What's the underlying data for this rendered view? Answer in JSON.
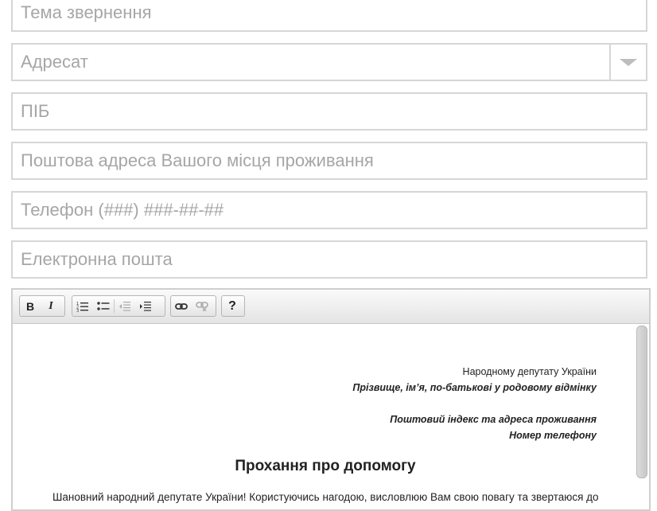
{
  "form": {
    "subject_placeholder": "Тема звернення",
    "addressee_placeholder": "Адресат",
    "name_placeholder": "ПІБ",
    "address_placeholder": "Поштова адреса Вашого місця проживання",
    "phone_placeholder": "Телефон (###) ###-##-##",
    "email_placeholder": "Електронна пошта"
  },
  "toolbar": {
    "bold": "B",
    "italic": "I",
    "help": "?"
  },
  "editor": {
    "line1": "Народному депутату України",
    "line2": "Прізвище, ім’я, по-батькові у родовому відмінку",
    "line3": "Поштовий індекс та адреса проживання",
    "line4": "Номер телефону",
    "heading": "Прохання про допомогу",
    "paragraph": "Шановний народний депутате України! Користуючись нагодою, висловлюю Вам свою повагу та звертаюся до"
  },
  "icons": {
    "dropdown": "chevron-down-icon",
    "ordered_list": "ordered-list-icon",
    "unordered_list": "unordered-list-icon",
    "outdent": "outdent-icon",
    "indent": "indent-icon",
    "link": "link-icon",
    "unlink": "unlink-icon"
  }
}
